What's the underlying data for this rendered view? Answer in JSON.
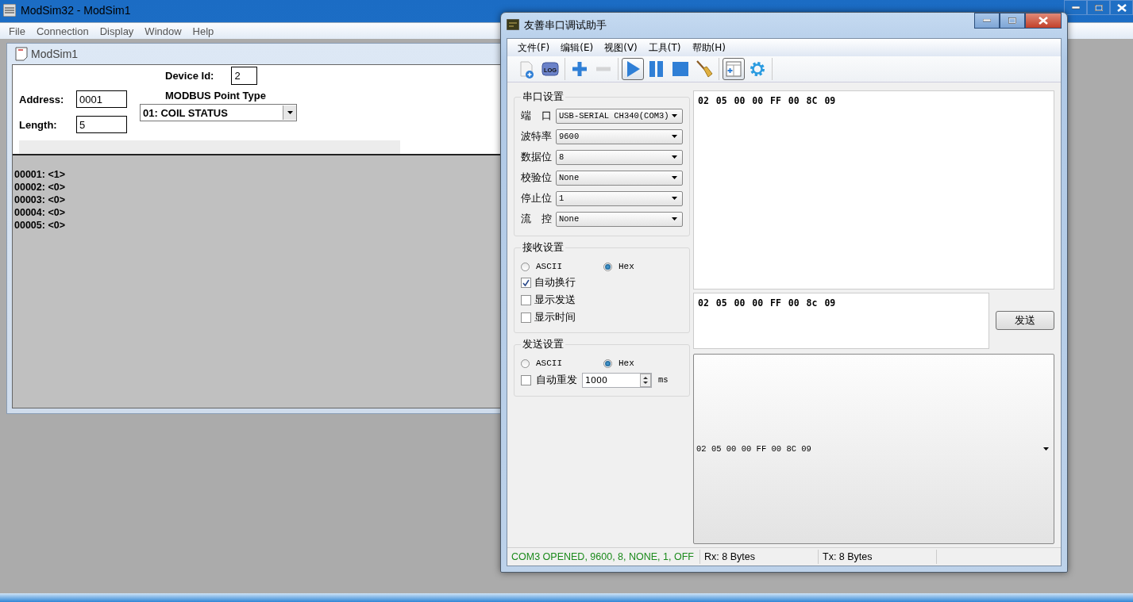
{
  "modsim": {
    "title": "ModSim32 - ModSim1",
    "menu": [
      "File",
      "Connection",
      "Display",
      "Window",
      "Help"
    ],
    "child": {
      "title": "ModSim1",
      "address_label": "Address:",
      "address": "0001",
      "length_label": "Length:",
      "length": "5",
      "device_id_label": "Device Id:",
      "device_id": "2",
      "point_type_label": "MODBUS Point Type",
      "point_type": "01: COIL STATUS",
      "values": [
        "00001: <1>",
        "00002: <0>",
        "00003: <0>",
        "00004: <0>",
        "00005: <0>"
      ]
    }
  },
  "serial": {
    "title": "友善串口调试助手",
    "menu": [
      "文件(F)",
      "编辑(E)",
      "视图(V)",
      "工具(T)",
      "帮助(H)"
    ],
    "toolbar_groups": [
      [
        {
          "kind": "new-file",
          "selected": false,
          "disabled": false
        },
        {
          "kind": "log",
          "label": "LOG",
          "selected": false,
          "disabled": false
        }
      ],
      [
        {
          "kind": "add",
          "selected": false,
          "disabled": false
        },
        {
          "kind": "remove",
          "selected": false,
          "disabled": true
        }
      ],
      [
        {
          "kind": "play",
          "selected": true,
          "disabled": false
        },
        {
          "kind": "pause",
          "selected": false,
          "disabled": false
        },
        {
          "kind": "stop",
          "selected": false,
          "disabled": false
        },
        {
          "kind": "broom",
          "selected": false,
          "disabled": false
        }
      ],
      [
        {
          "kind": "window-add",
          "selected": true,
          "disabled": false
        },
        {
          "kind": "gear",
          "selected": false,
          "disabled": false
        }
      ]
    ],
    "port_settings": {
      "title": "串口设置",
      "fields": [
        {
          "label": "端　口",
          "value": "USB-SERIAL CH340(COM3)"
        },
        {
          "label": "波特率",
          "value": "9600"
        },
        {
          "label": "数据位",
          "value": "8"
        },
        {
          "label": "校验位",
          "value": "None"
        },
        {
          "label": "停止位",
          "value": "1"
        },
        {
          "label": "流　控",
          "value": "None"
        }
      ]
    },
    "receive_settings": {
      "title": "接收设置",
      "modes": [
        {
          "label": "ASCII",
          "selected": false
        },
        {
          "label": "Hex",
          "selected": true
        }
      ],
      "options": [
        {
          "label": "自动换行",
          "checked": true
        },
        {
          "label": "显示发送",
          "checked": false
        },
        {
          "label": "显示时间",
          "checked": false
        }
      ]
    },
    "send_settings": {
      "title": "发送设置",
      "modes": [
        {
          "label": "ASCII",
          "selected": false
        },
        {
          "label": "Hex",
          "selected": true
        }
      ],
      "auto_resend": {
        "label": "自动重发",
        "checked": false,
        "interval": "1000",
        "unit": "ms"
      }
    },
    "receive_text": "02 05 00 00 FF 00 8C 09",
    "send_text": "02 05 00 00 FF 00 8c 09",
    "send_button": "发送",
    "history": "02 05 00 00 FF 00 8C 09",
    "status": [
      "COM3 OPENED, 9600, 8, NONE, 1, OFF",
      "Rx: 8 Bytes",
      "Tx: 8 Bytes"
    ]
  }
}
